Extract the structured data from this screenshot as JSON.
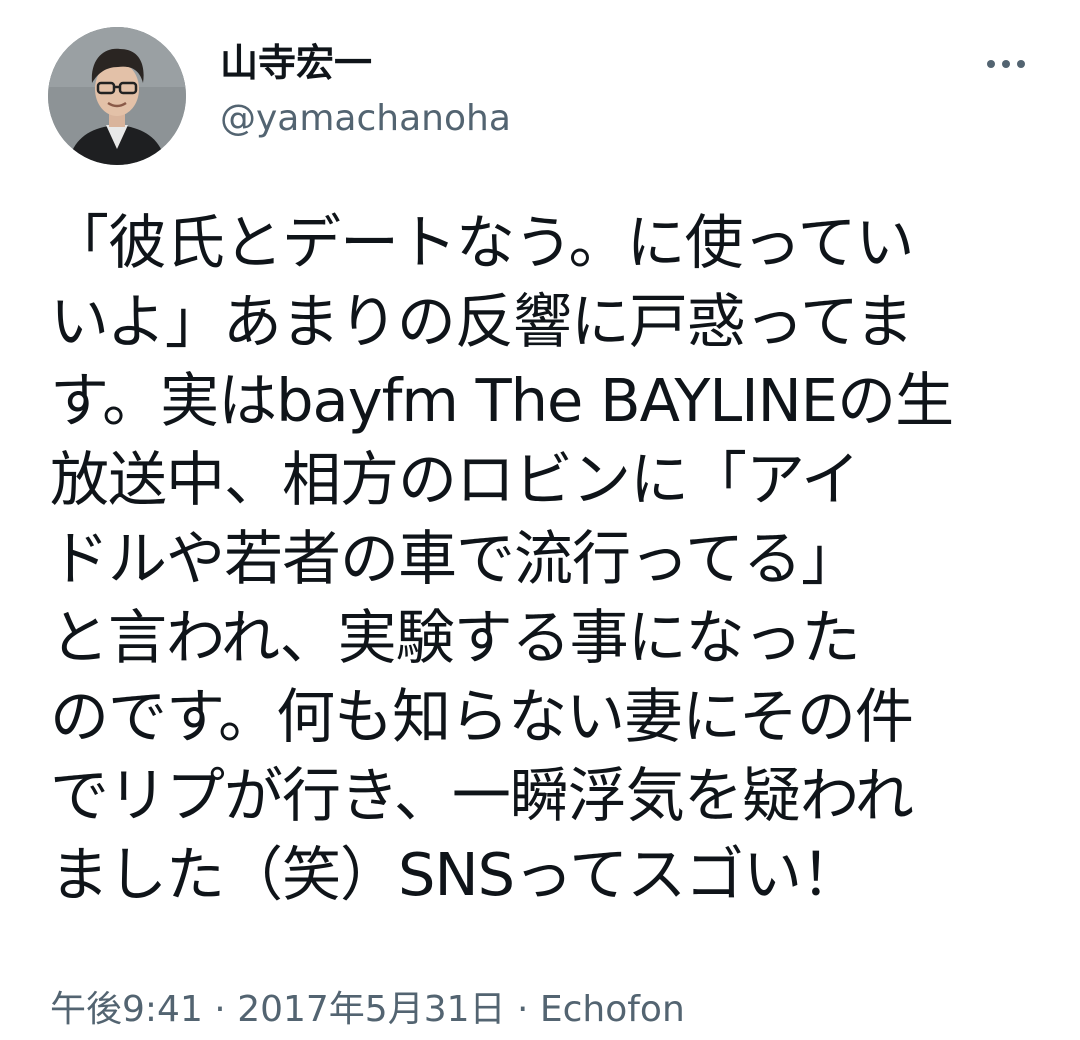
{
  "author": {
    "display_name": "山寺宏一",
    "handle": "@yamachanoha"
  },
  "more_icon": "more-horizontal-icon",
  "tweet": {
    "lines": [
      "「彼氏とデートなう。に使ってい",
      "いよ」あまりの反響に戸惑ってま",
      "す。実はbayfm The BAYLINEの生",
      "放送中、相方のロビンに「アイ",
      "ドルや若者の車で流行ってる」",
      "と言われ、実験する事になった",
      "のです。何も知らない妻にその件",
      "でリプが行き、一瞬浮気を疑われ",
      "ました（笑）SNSってスゴい！"
    ]
  },
  "meta": {
    "time": "午後9:41",
    "separator": " · ",
    "date": "2017年5月31日",
    "source": "Echofon"
  },
  "colors": {
    "text_primary": "#0f1419",
    "text_secondary": "#536471",
    "background": "#ffffff"
  }
}
